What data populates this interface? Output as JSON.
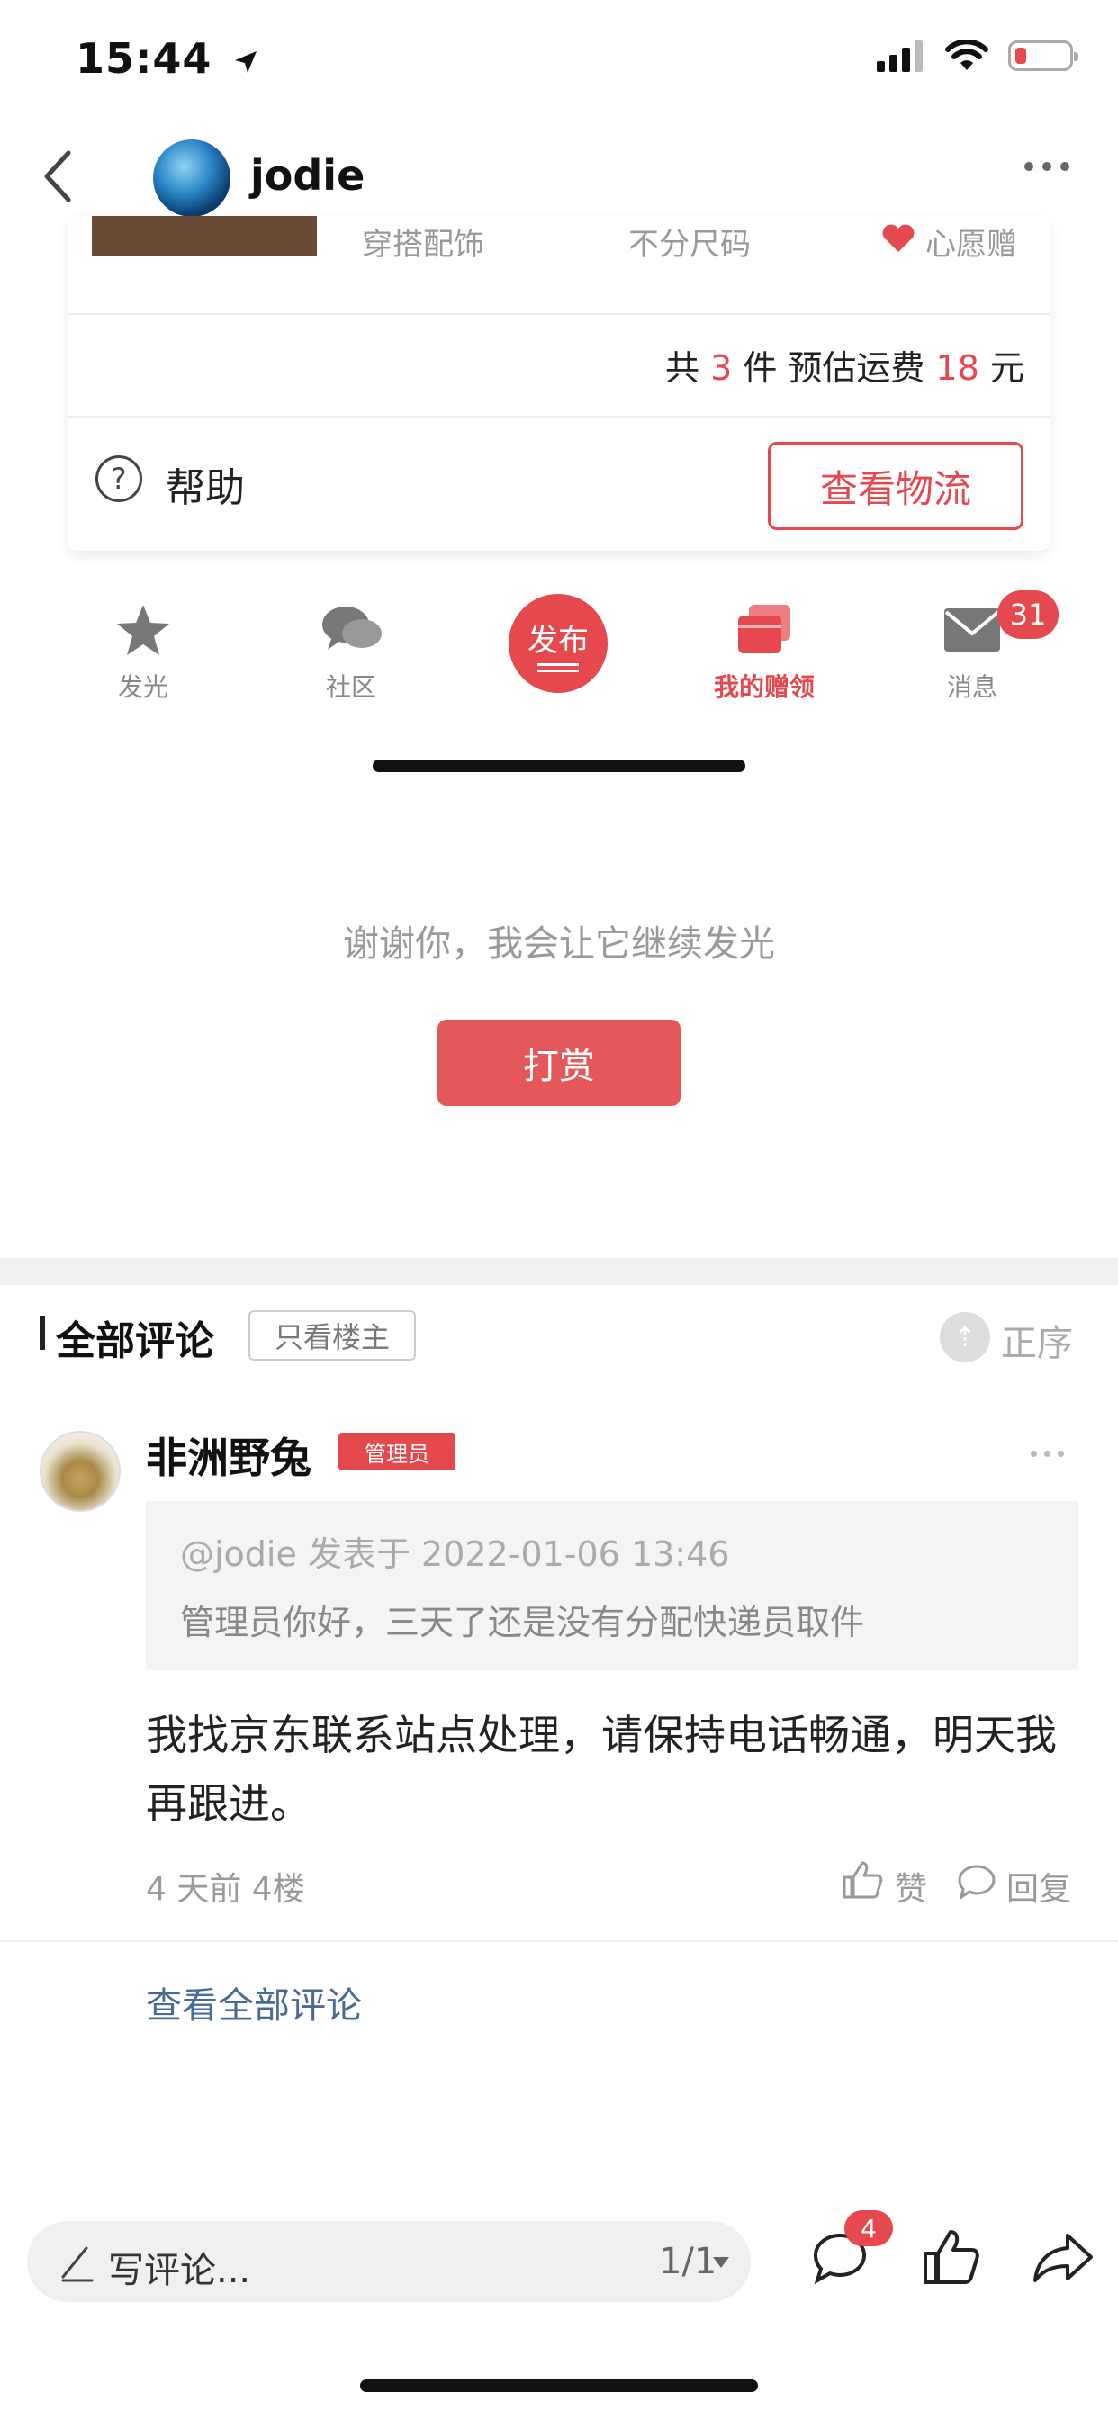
{
  "status_bar": {
    "time": "15:44"
  },
  "header": {
    "title": "jodie"
  },
  "order_card": {
    "partial_item_texts": [
      "穿搭配饰",
      "不分尺码",
      "心愿赠"
    ],
    "summary": {
      "prefix": "共",
      "count": "3",
      "count_unit": "件 预估运费",
      "fee": "18",
      "fee_unit": "元"
    },
    "help_label": "帮助",
    "logistics_button": "查看物流"
  },
  "tabbar": {
    "tabs": [
      {
        "label": "发光",
        "icon": "star-icon"
      },
      {
        "label": "社区",
        "icon": "chat-bubbles-icon"
      },
      {
        "label": "发布",
        "icon": "publish-icon"
      },
      {
        "label": "我的赠领",
        "icon": "gift-cards-icon",
        "active": true
      },
      {
        "label": "消息",
        "icon": "mail-icon"
      }
    ],
    "message_badge": "31",
    "accent_color": "#e5484d"
  },
  "thanks": {
    "text": "谢谢你，我会让它继续发光",
    "tip_button": "打赏"
  },
  "comments": {
    "title": "全部评论",
    "only_op": "只看楼主",
    "sort_label": "正序",
    "items": [
      {
        "author": "非洲野兔",
        "badge": "管理员",
        "quote_meta": "@jodie 发表于 2022-01-06 13:46",
        "quote_text": "管理员你好，三天了还是没有分配快递员取件",
        "body": "我找京东联系站点处理，请保持电话畅通，明天我再跟进。",
        "time": "4 天前  4楼",
        "like_label": "赞",
        "reply_label": "回复"
      }
    ],
    "view_all": "查看全部评论"
  },
  "bottom_bar": {
    "input_placeholder": "写评论...",
    "page_indicator": "1/1",
    "comment_badge": "4"
  }
}
